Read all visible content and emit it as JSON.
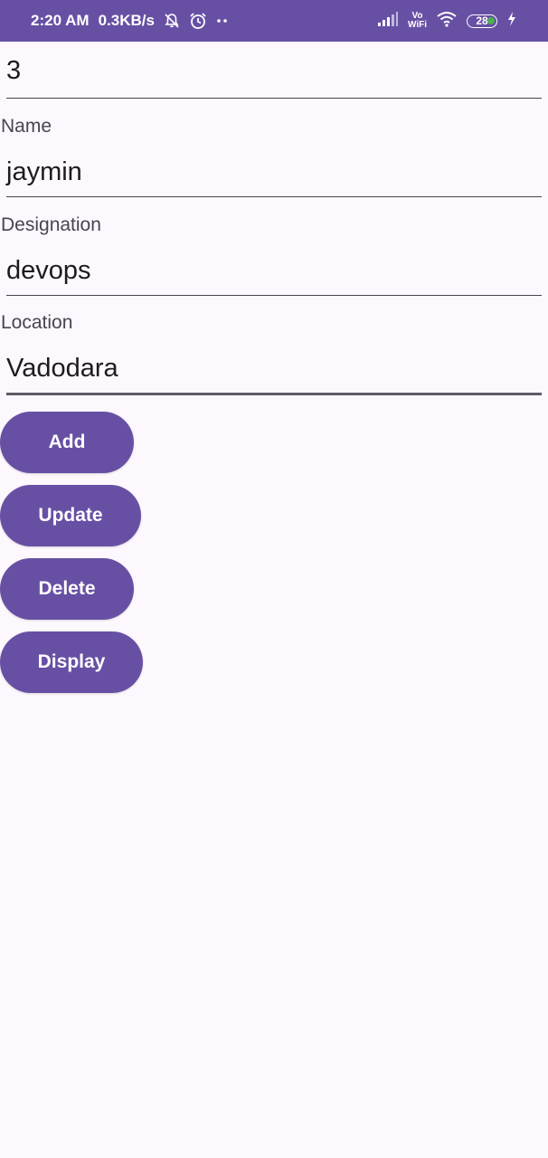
{
  "status_bar": {
    "time": "2:20 AM",
    "speed": "0.3KB/s",
    "vowifi_top": "Vo",
    "vowifi_bottom": "WiFi",
    "battery": "28"
  },
  "form": {
    "id_value": "3",
    "name_label": "Name",
    "name_value": "jaymin",
    "designation_label": "Designation",
    "designation_value": "devops",
    "location_label": "Location",
    "location_value": "Vadodara"
  },
  "buttons": {
    "add": "Add",
    "update": "Update",
    "delete": "Delete",
    "display": "Display"
  },
  "colors": {
    "primary": "#6750a4",
    "background": "#fdf8fd"
  }
}
